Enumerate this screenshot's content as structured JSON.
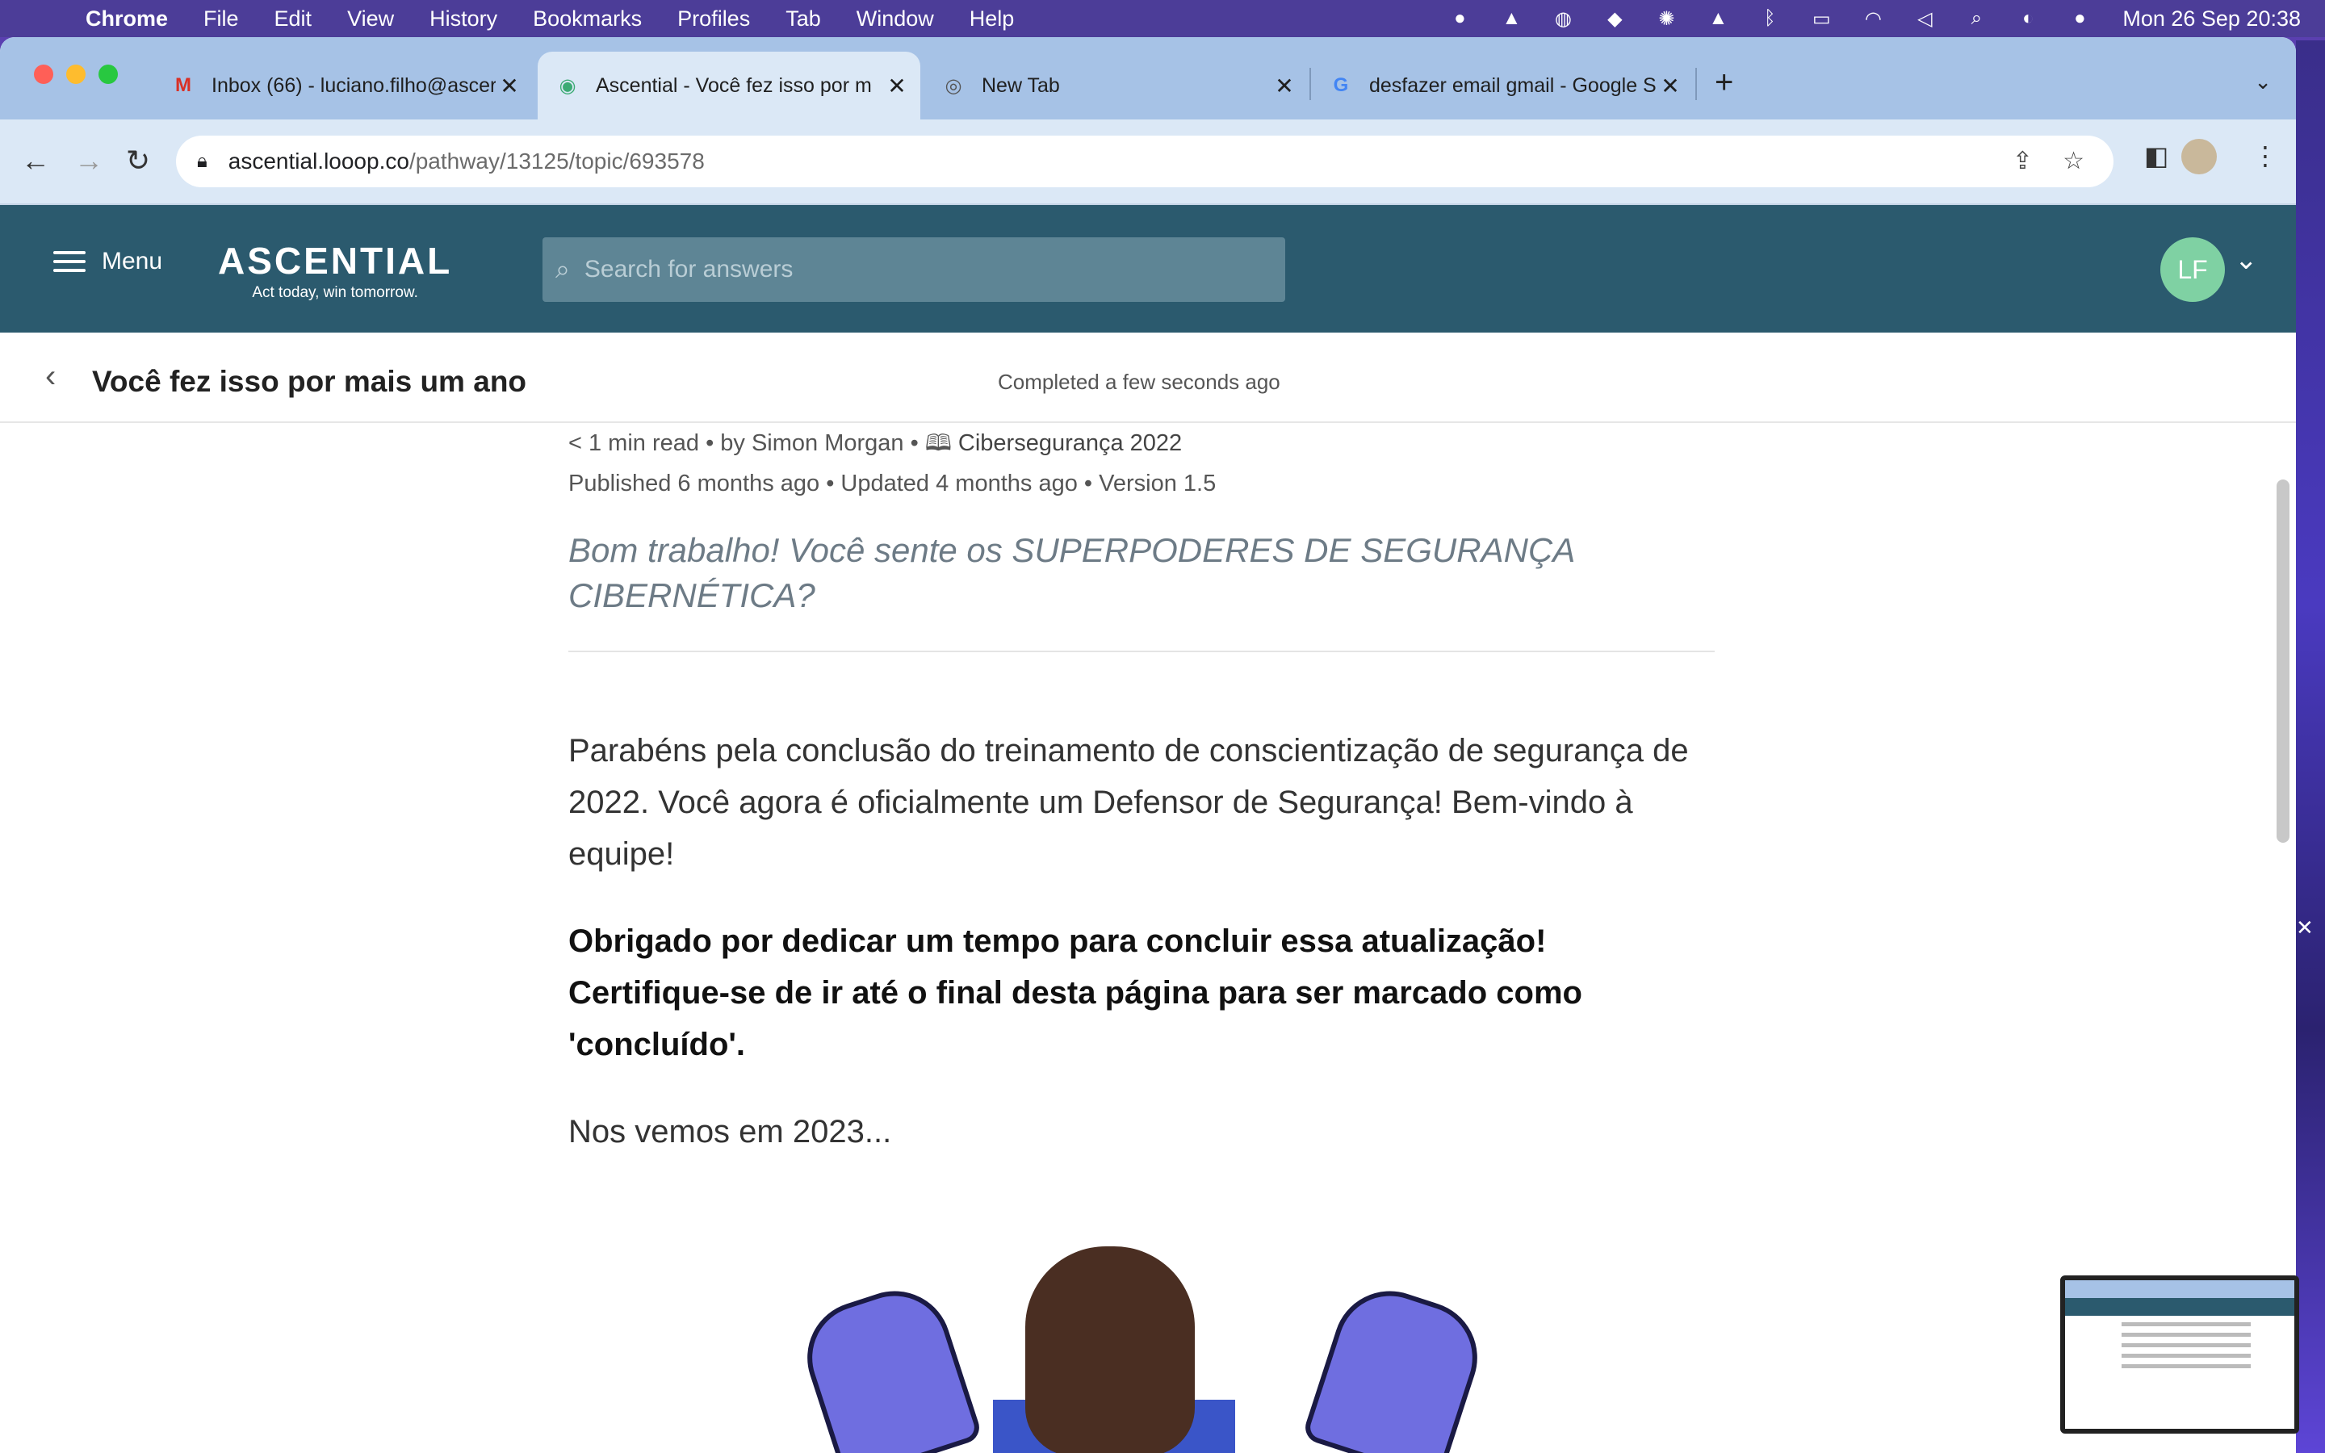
{
  "menubar": {
    "app": "Chrome",
    "items": [
      "File",
      "Edit",
      "View",
      "History",
      "Bookmarks",
      "Profiles",
      "Tab",
      "Window",
      "Help"
    ],
    "clock": "Mon 26 Sep  20:38"
  },
  "tabs": [
    {
      "title": "Inbox (66) - luciano.filho@ascer",
      "favicon": "gmail-icon"
    },
    {
      "title": "Ascential - Você fez isso por m",
      "favicon": "looop-icon"
    },
    {
      "title": "New Tab",
      "favicon": "chrome-icon"
    },
    {
      "title": "desfazer email gmail - Google S",
      "favicon": "google-icon"
    }
  ],
  "omnibox": {
    "domain": "ascential.looop.co",
    "path": "/pathway/13125/topic/693578"
  },
  "app": {
    "menu_label": "Menu",
    "brand": "ASCENTIAL",
    "tagline": "Act today, win tomorrow.",
    "search_placeholder": "Search for answers",
    "avatar_initials": "LF"
  },
  "topic": {
    "title": "Você fez isso por mais um ano",
    "status": "Completed a few seconds ago",
    "meta_line1_pre": "< 1 min read • by Simon Morgan • ",
    "pathway": "Cibersegurança 2022",
    "meta_line2": "Published 6 months ago • Updated 4 months ago • Version 1.5",
    "lead": "Bom trabalho! Você sente os SUPERPODERES DE SEGURANÇA CIBERNÉTICA?",
    "p1": "Parabéns pela conclusão do treinamento de conscientização de segurança de 2022. Você agora é oficialmente um Defensor de Segurança! Bem-vindo à equipe!",
    "p2": "Obrigado por dedicar um tempo para concluir essa atualização! Certifique-se de ir até o final desta página para ser marcado como 'concluído'.",
    "p3": "Nos vemos em 2023..."
  },
  "colors": {
    "header": "#2b5a6e",
    "tabstrip": "#a6c2e6",
    "avatar": "#7fd1a3"
  }
}
